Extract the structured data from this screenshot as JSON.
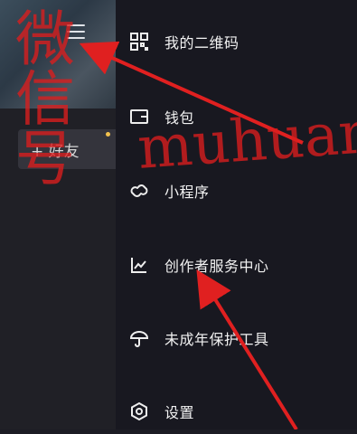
{
  "left_panel": {
    "add_friend_label": "+ 好友"
  },
  "menu": {
    "items": [
      {
        "label": "我的二维码",
        "icon": "qr-code-icon"
      },
      {
        "label": "钱包",
        "icon": "wallet-icon"
      },
      {
        "label": "小程序",
        "icon": "mini-program-icon"
      },
      {
        "label": "创作者服务中心",
        "icon": "creator-chart-icon"
      },
      {
        "label": "未成年保护工具",
        "icon": "umbrella-icon"
      },
      {
        "label": "设置",
        "icon": "settings-icon"
      }
    ]
  },
  "watermark": {
    "left_text": "微信号",
    "right_text": "muhuanidc"
  },
  "colors": {
    "watermark": "#dc1e1e",
    "arrow": "#e02020",
    "badge": "#f2c14e"
  }
}
